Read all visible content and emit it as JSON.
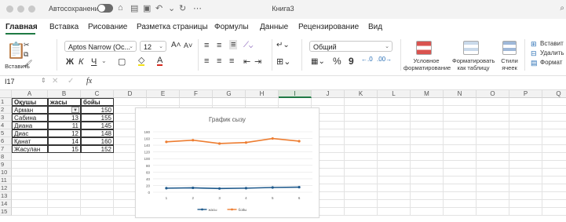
{
  "window": {
    "autosave_label": "Автосохранение",
    "title": "Книга3"
  },
  "tabs": [
    "Главная",
    "Вставка",
    "Рисование",
    "Разметка страницы",
    "Формулы",
    "Данные",
    "Рецензирование",
    "Вид"
  ],
  "ribbon": {
    "paste_label": "Вставить",
    "font_name": "Aptos Narrow (Ос...",
    "font_size": "12",
    "bold": "Ж",
    "italic": "К",
    "underline": "Ч",
    "number_format": "Общий",
    "percent": "%",
    "comma": "9",
    "conditional_format": "Условное форматирование",
    "format_table": "Форматировать как таблицу",
    "cell_styles": "Стили ячеек",
    "insert": "Вставит",
    "delete": "Удалить",
    "format": "Формат"
  },
  "formula_bar": {
    "name_box": "I17",
    "fx": "fx",
    "formula": ""
  },
  "sheet": {
    "columns": [
      "A",
      "B",
      "C",
      "D",
      "E",
      "F",
      "G",
      "H",
      "I",
      "J",
      "K",
      "L",
      "M",
      "N",
      "O",
      "P",
      "Q"
    ],
    "selected_column": "I",
    "rows": [
      "1",
      "2",
      "3",
      "4",
      "5",
      "6",
      "7",
      "8",
      "9",
      "10",
      "11",
      "12",
      "13",
      "14",
      "15"
    ],
    "table": [
      [
        "Оқушы",
        "жасы",
        "бойы"
      ],
      [
        "Арман",
        "",
        "150"
      ],
      [
        "Сабина",
        "13",
        "155"
      ],
      [
        "Диана",
        "11",
        "145"
      ],
      [
        "Диас",
        "12",
        "148"
      ],
      [
        "Қанат",
        "14",
        "160"
      ],
      [
        "Жасулан",
        "15",
        "152"
      ]
    ]
  },
  "chart_data": {
    "type": "line",
    "title": "График сызу",
    "x": [
      1,
      2,
      3,
      4,
      5,
      6
    ],
    "ylim": [
      0,
      180
    ],
    "yticks": [
      0,
      20,
      40,
      60,
      80,
      100,
      120,
      140,
      160,
      180
    ],
    "series": [
      {
        "name": "жасы",
        "values": [
          12,
          13,
          11,
          12,
          14,
          15
        ],
        "color": "#1f5a8c"
      },
      {
        "name": "бойы",
        "values": [
          150,
          155,
          145,
          148,
          160,
          152
        ],
        "color": "#ed7d31"
      }
    ],
    "legend": "bottom"
  },
  "colors": {
    "accent": "#1f7a44",
    "line_blue": "#1f5a8c",
    "line_orange": "#ed7d31"
  }
}
